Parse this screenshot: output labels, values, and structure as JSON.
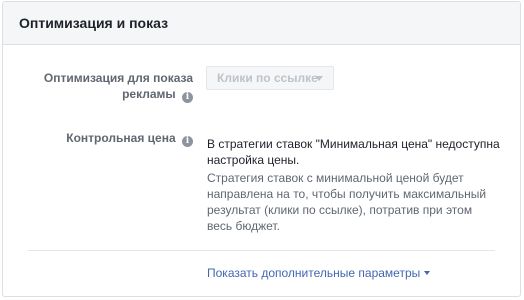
{
  "panel": {
    "title": "Оптимизация и показ"
  },
  "optimization": {
    "label": "Оптимизация для показа рекламы",
    "info_icon": "info-icon",
    "dropdown_value": "Клики по ссылке",
    "dropdown_disabled": true
  },
  "bid_control": {
    "label": "Контрольная цена",
    "info_icon": "info-icon",
    "notice": "В стратегии ставок \"Минимальная цена\" недоступна настройка цены.",
    "description": "Стратегия ставок с минимальной ценой будет направлена на то, чтобы получить максимальный результат (клики по ссылке), потратив при этом весь бюджет."
  },
  "footer": {
    "more_options_link": "Показать дополнительные параметры"
  },
  "colors": {
    "link": "#4267b2",
    "header_bg": "#f5f6f7",
    "border": "#dddfe2",
    "muted_text": "#606770"
  }
}
